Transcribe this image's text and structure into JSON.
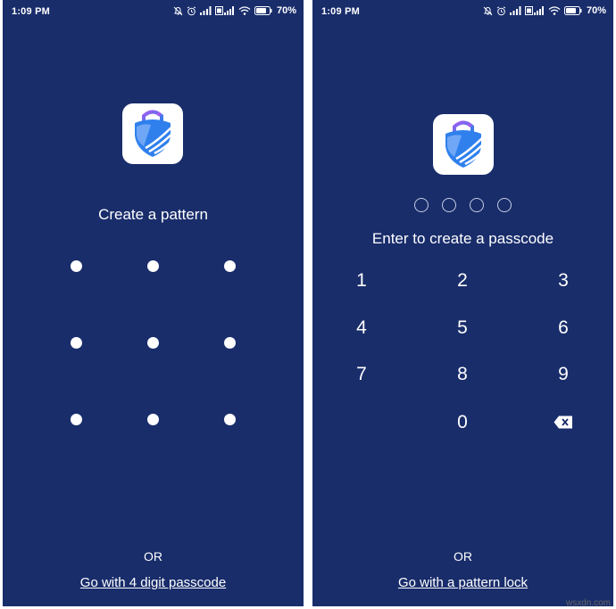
{
  "left_screen": {
    "status": {
      "time": "1:09 PM",
      "battery": "70%"
    },
    "heading": "Create a pattern",
    "pattern_dots": 9,
    "or_label": "OR",
    "alt_link": "Go with 4 digit passcode"
  },
  "right_screen": {
    "status": {
      "time": "1:09 PM",
      "battery": "70%"
    },
    "passcode_slots": 4,
    "heading": "Enter to create a passcode",
    "keypad": [
      "1",
      "2",
      "3",
      "4",
      "5",
      "6",
      "7",
      "8",
      "9",
      "0"
    ],
    "backspace_icon": "backspace-icon",
    "or_label": "OR",
    "alt_link": "Go with a pattern lock"
  },
  "watermark": "wsxdn.com",
  "colors": {
    "background": "#192d6b",
    "text": "#ffffff",
    "icon_bg": "#ffffff",
    "icon_blue": "#2f80ed",
    "icon_purple": "#7b5cf0"
  }
}
